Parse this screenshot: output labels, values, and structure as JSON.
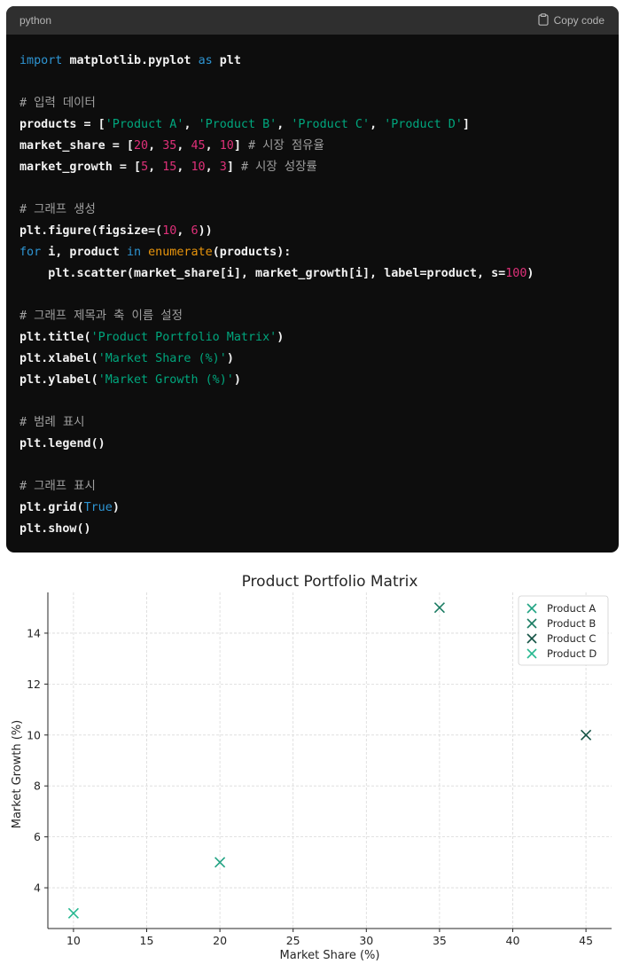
{
  "code_block": {
    "language": "python",
    "copy_label": "Copy code",
    "lines": [
      [
        {
          "t": "kw",
          "v": "import "
        },
        {
          "t": "plain",
          "v": "matplotlib.pyplot "
        },
        {
          "t": "kw",
          "v": "as "
        },
        {
          "t": "plain",
          "v": "plt"
        }
      ],
      [],
      [
        {
          "t": "cm",
          "v": "# 입력 데이터"
        }
      ],
      [
        {
          "t": "plain",
          "v": "products = ["
        },
        {
          "t": "str",
          "v": "'Product A'"
        },
        {
          "t": "plain",
          "v": ", "
        },
        {
          "t": "str",
          "v": "'Product B'"
        },
        {
          "t": "plain",
          "v": ", "
        },
        {
          "t": "str",
          "v": "'Product C'"
        },
        {
          "t": "plain",
          "v": ", "
        },
        {
          "t": "str",
          "v": "'Product D'"
        },
        {
          "t": "plain",
          "v": "]"
        }
      ],
      [
        {
          "t": "plain",
          "v": "market_share = ["
        },
        {
          "t": "num",
          "v": "20"
        },
        {
          "t": "plain",
          "v": ", "
        },
        {
          "t": "num",
          "v": "35"
        },
        {
          "t": "plain",
          "v": ", "
        },
        {
          "t": "num",
          "v": "45"
        },
        {
          "t": "plain",
          "v": ", "
        },
        {
          "t": "num",
          "v": "10"
        },
        {
          "t": "plain",
          "v": "] "
        },
        {
          "t": "cm",
          "v": "# 시장 점유율"
        }
      ],
      [
        {
          "t": "plain",
          "v": "market_growth = ["
        },
        {
          "t": "num",
          "v": "5"
        },
        {
          "t": "plain",
          "v": ", "
        },
        {
          "t": "num",
          "v": "15"
        },
        {
          "t": "plain",
          "v": ", "
        },
        {
          "t": "num",
          "v": "10"
        },
        {
          "t": "plain",
          "v": ", "
        },
        {
          "t": "num",
          "v": "3"
        },
        {
          "t": "plain",
          "v": "] "
        },
        {
          "t": "cm",
          "v": "# 시장 성장률"
        }
      ],
      [],
      [
        {
          "t": "cm",
          "v": "# 그래프 생성"
        }
      ],
      [
        {
          "t": "plain",
          "v": "plt.figure(figsize=("
        },
        {
          "t": "num",
          "v": "10"
        },
        {
          "t": "plain",
          "v": ", "
        },
        {
          "t": "num",
          "v": "6"
        },
        {
          "t": "plain",
          "v": "))"
        }
      ],
      [
        {
          "t": "kw",
          "v": "for "
        },
        {
          "t": "plain",
          "v": "i, product "
        },
        {
          "t": "kw",
          "v": "in "
        },
        {
          "t": "bi",
          "v": "enumerate"
        },
        {
          "t": "plain",
          "v": "(products):"
        }
      ],
      [
        {
          "t": "plain",
          "v": "    plt.scatter(market_share[i], market_growth[i], label=product, s="
        },
        {
          "t": "num",
          "v": "100"
        },
        {
          "t": "plain",
          "v": ")"
        }
      ],
      [],
      [
        {
          "t": "cm",
          "v": "# 그래프 제목과 축 이름 설정"
        }
      ],
      [
        {
          "t": "plain",
          "v": "plt.title("
        },
        {
          "t": "str",
          "v": "'Product Portfolio Matrix'"
        },
        {
          "t": "plain",
          "v": ")"
        }
      ],
      [
        {
          "t": "plain",
          "v": "plt.xlabel("
        },
        {
          "t": "str",
          "v": "'Market Share (%)'"
        },
        {
          "t": "plain",
          "v": ")"
        }
      ],
      [
        {
          "t": "plain",
          "v": "plt.ylabel("
        },
        {
          "t": "str",
          "v": "'Market Growth (%)'"
        },
        {
          "t": "plain",
          "v": ")"
        }
      ],
      [],
      [
        {
          "t": "cm",
          "v": "# 범례 표시"
        }
      ],
      [
        {
          "t": "plain",
          "v": "plt.legend()"
        }
      ],
      [],
      [
        {
          "t": "cm",
          "v": "# 그래프 표시"
        }
      ],
      [
        {
          "t": "plain",
          "v": "plt.grid("
        },
        {
          "t": "kw",
          "v": "True"
        },
        {
          "t": "plain",
          "v": ")"
        }
      ],
      [
        {
          "t": "plain",
          "v": "plt.show()"
        }
      ]
    ]
  },
  "chart_data": {
    "type": "scatter",
    "title": "Product Portfolio Matrix",
    "xlabel": "Market Share (%)",
    "ylabel": "Market Growth (%)",
    "xlim": [
      8.25,
      46.75
    ],
    "ylim": [
      2.4,
      15.6
    ],
    "xticks": [
      10,
      15,
      20,
      25,
      30,
      35,
      40,
      45
    ],
    "yticks": [
      4,
      6,
      8,
      10,
      12,
      14
    ],
    "grid": true,
    "legend_position": "top-right",
    "marker": "x",
    "series": [
      {
        "name": "Product A",
        "x": 20,
        "y": 5,
        "color": "#21a383"
      },
      {
        "name": "Product B",
        "x": 35,
        "y": 15,
        "color": "#1b7c63"
      },
      {
        "name": "Product C",
        "x": 45,
        "y": 10,
        "color": "#145244"
      },
      {
        "name": "Product D",
        "x": 10,
        "y": 3,
        "color": "#28b891"
      }
    ]
  }
}
